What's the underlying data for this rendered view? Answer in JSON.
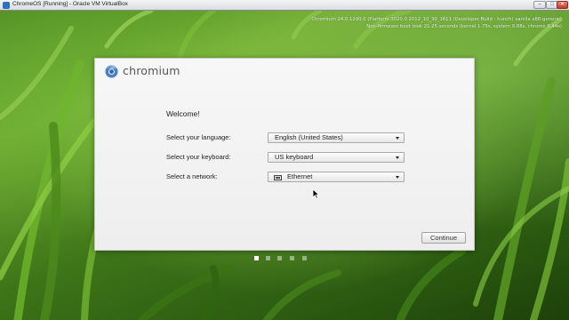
{
  "window": {
    "title": "ChromeOS [Running] - Oracle VM VirtualBox",
    "minimize_glyph": "–",
    "maximize_glyph": "□",
    "close_glyph": "✕"
  },
  "sysinfo": {
    "line1": "Chromium 24.0.1290.0 (Platform 3020.0.2012_10_30_1611 (Developer Build - hunch) vanilla x86-generic)",
    "line2": "Non-firmware boot took 21.25 seconds (kernel 1.75s, system 9.88s, chrome 6.44s)"
  },
  "brand": {
    "name": "chromium",
    "logo_icon": "chromium-logo-icon"
  },
  "oobe": {
    "welcome": "Welcome!",
    "language_label": "Select your language:",
    "language_value": "English (United States)",
    "keyboard_label": "Select your keyboard:",
    "keyboard_value": "US keyboard",
    "network_label": "Select a network:",
    "network_value": "Ethernet",
    "network_icon": "ethernet-icon",
    "continue_label": "Continue"
  },
  "progress": {
    "total_steps": 5,
    "current_step": 1
  },
  "colors": {
    "card_bg": "#f2f2f2",
    "wallpaper_green": "#4f8c22"
  }
}
